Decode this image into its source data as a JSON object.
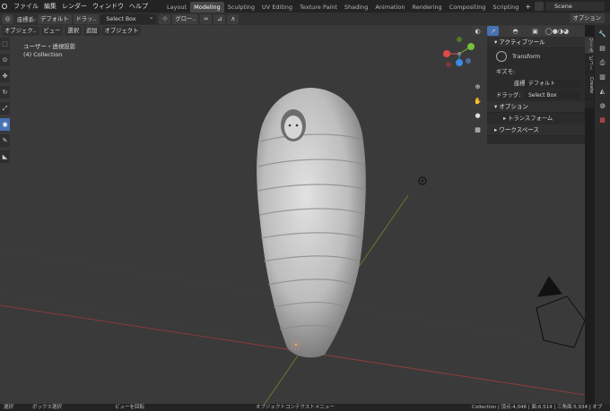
{
  "menu": {
    "items": [
      "ファイル",
      "編集",
      "レンダー",
      "ウィンドウ",
      "ヘルプ"
    ]
  },
  "workspaces": {
    "tabs": [
      "Layout",
      "Modeling",
      "Sculpting",
      "UV Editing",
      "Texture Paint",
      "Shading",
      "Animation",
      "Rendering",
      "Compositing",
      "Scripting"
    ],
    "active": "Modeling"
  },
  "scene": {
    "name": "Scene"
  },
  "tool_header": {
    "coord_label": "座標系:",
    "coord_value": "デフォルト",
    "drag_label": "ドラッ..",
    "drag_value": "Select Box",
    "pivot_value": "グロー..",
    "options_label": "オプション"
  },
  "viewport_header": {
    "mode": "オブジェク..",
    "items": [
      "ビュー",
      "選択",
      "追加",
      "オブジェクト"
    ]
  },
  "viewport": {
    "view_name": "ユーザー・透視投影",
    "collection": "(4) Collection"
  },
  "npanel": {
    "active_tool_header": "アクティブツール",
    "tool_name": "Transform",
    "gizmo_label": "ギズモ:",
    "coord_label": "座標系:",
    "coord_value": "デフォルト",
    "drag_label": "ドラッグ:",
    "drag_value": "Select Box",
    "options_header": "オプション",
    "transform_sub": "トランスフォーム",
    "workspace_header": "ワークスペース"
  },
  "vtabs": [
    "ツール",
    "ビュー",
    "Create"
  ],
  "statusbar": {
    "select": "選択",
    "box_select": "ボックス選択",
    "rotate_view": "ビューを回転",
    "context_menu": "オブジェクトコンテクストメニュー",
    "stats": "Collection | 頂点:4,046 | 面:6,514 | 三角面:5,934 | オブ"
  },
  "colors": {
    "accent": "#4772b3",
    "x_axis": "#a03a3a",
    "y_axis": "#6b8a2a",
    "gizmo_x": "#e34a4a",
    "gizmo_y": "#78c03b",
    "gizmo_z": "#3a8ae6"
  }
}
